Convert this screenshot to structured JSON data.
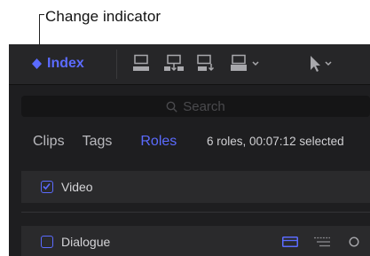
{
  "callout": {
    "label": "Change indicator"
  },
  "toolbar": {
    "index_label": "Index",
    "icons": [
      "clip-append-icon",
      "clip-insert-icon",
      "clip-connect-icon",
      "clip-overwrite-icon",
      "select-tool-icon"
    ]
  },
  "search": {
    "placeholder": "Search"
  },
  "tabs": [
    {
      "label": "Clips",
      "active": false
    },
    {
      "label": "Tags",
      "active": false
    },
    {
      "label": "Roles",
      "active": true
    }
  ],
  "summary": "6 roles, 00:07:12 selected",
  "roles": [
    {
      "label": "Video",
      "checked": true
    },
    {
      "label": "Dialogue",
      "checked": false
    }
  ],
  "colors": {
    "accent": "#5b6bff",
    "background": "#1e1e20",
    "toolbar": "#262628",
    "row": "#2a2a2c"
  }
}
